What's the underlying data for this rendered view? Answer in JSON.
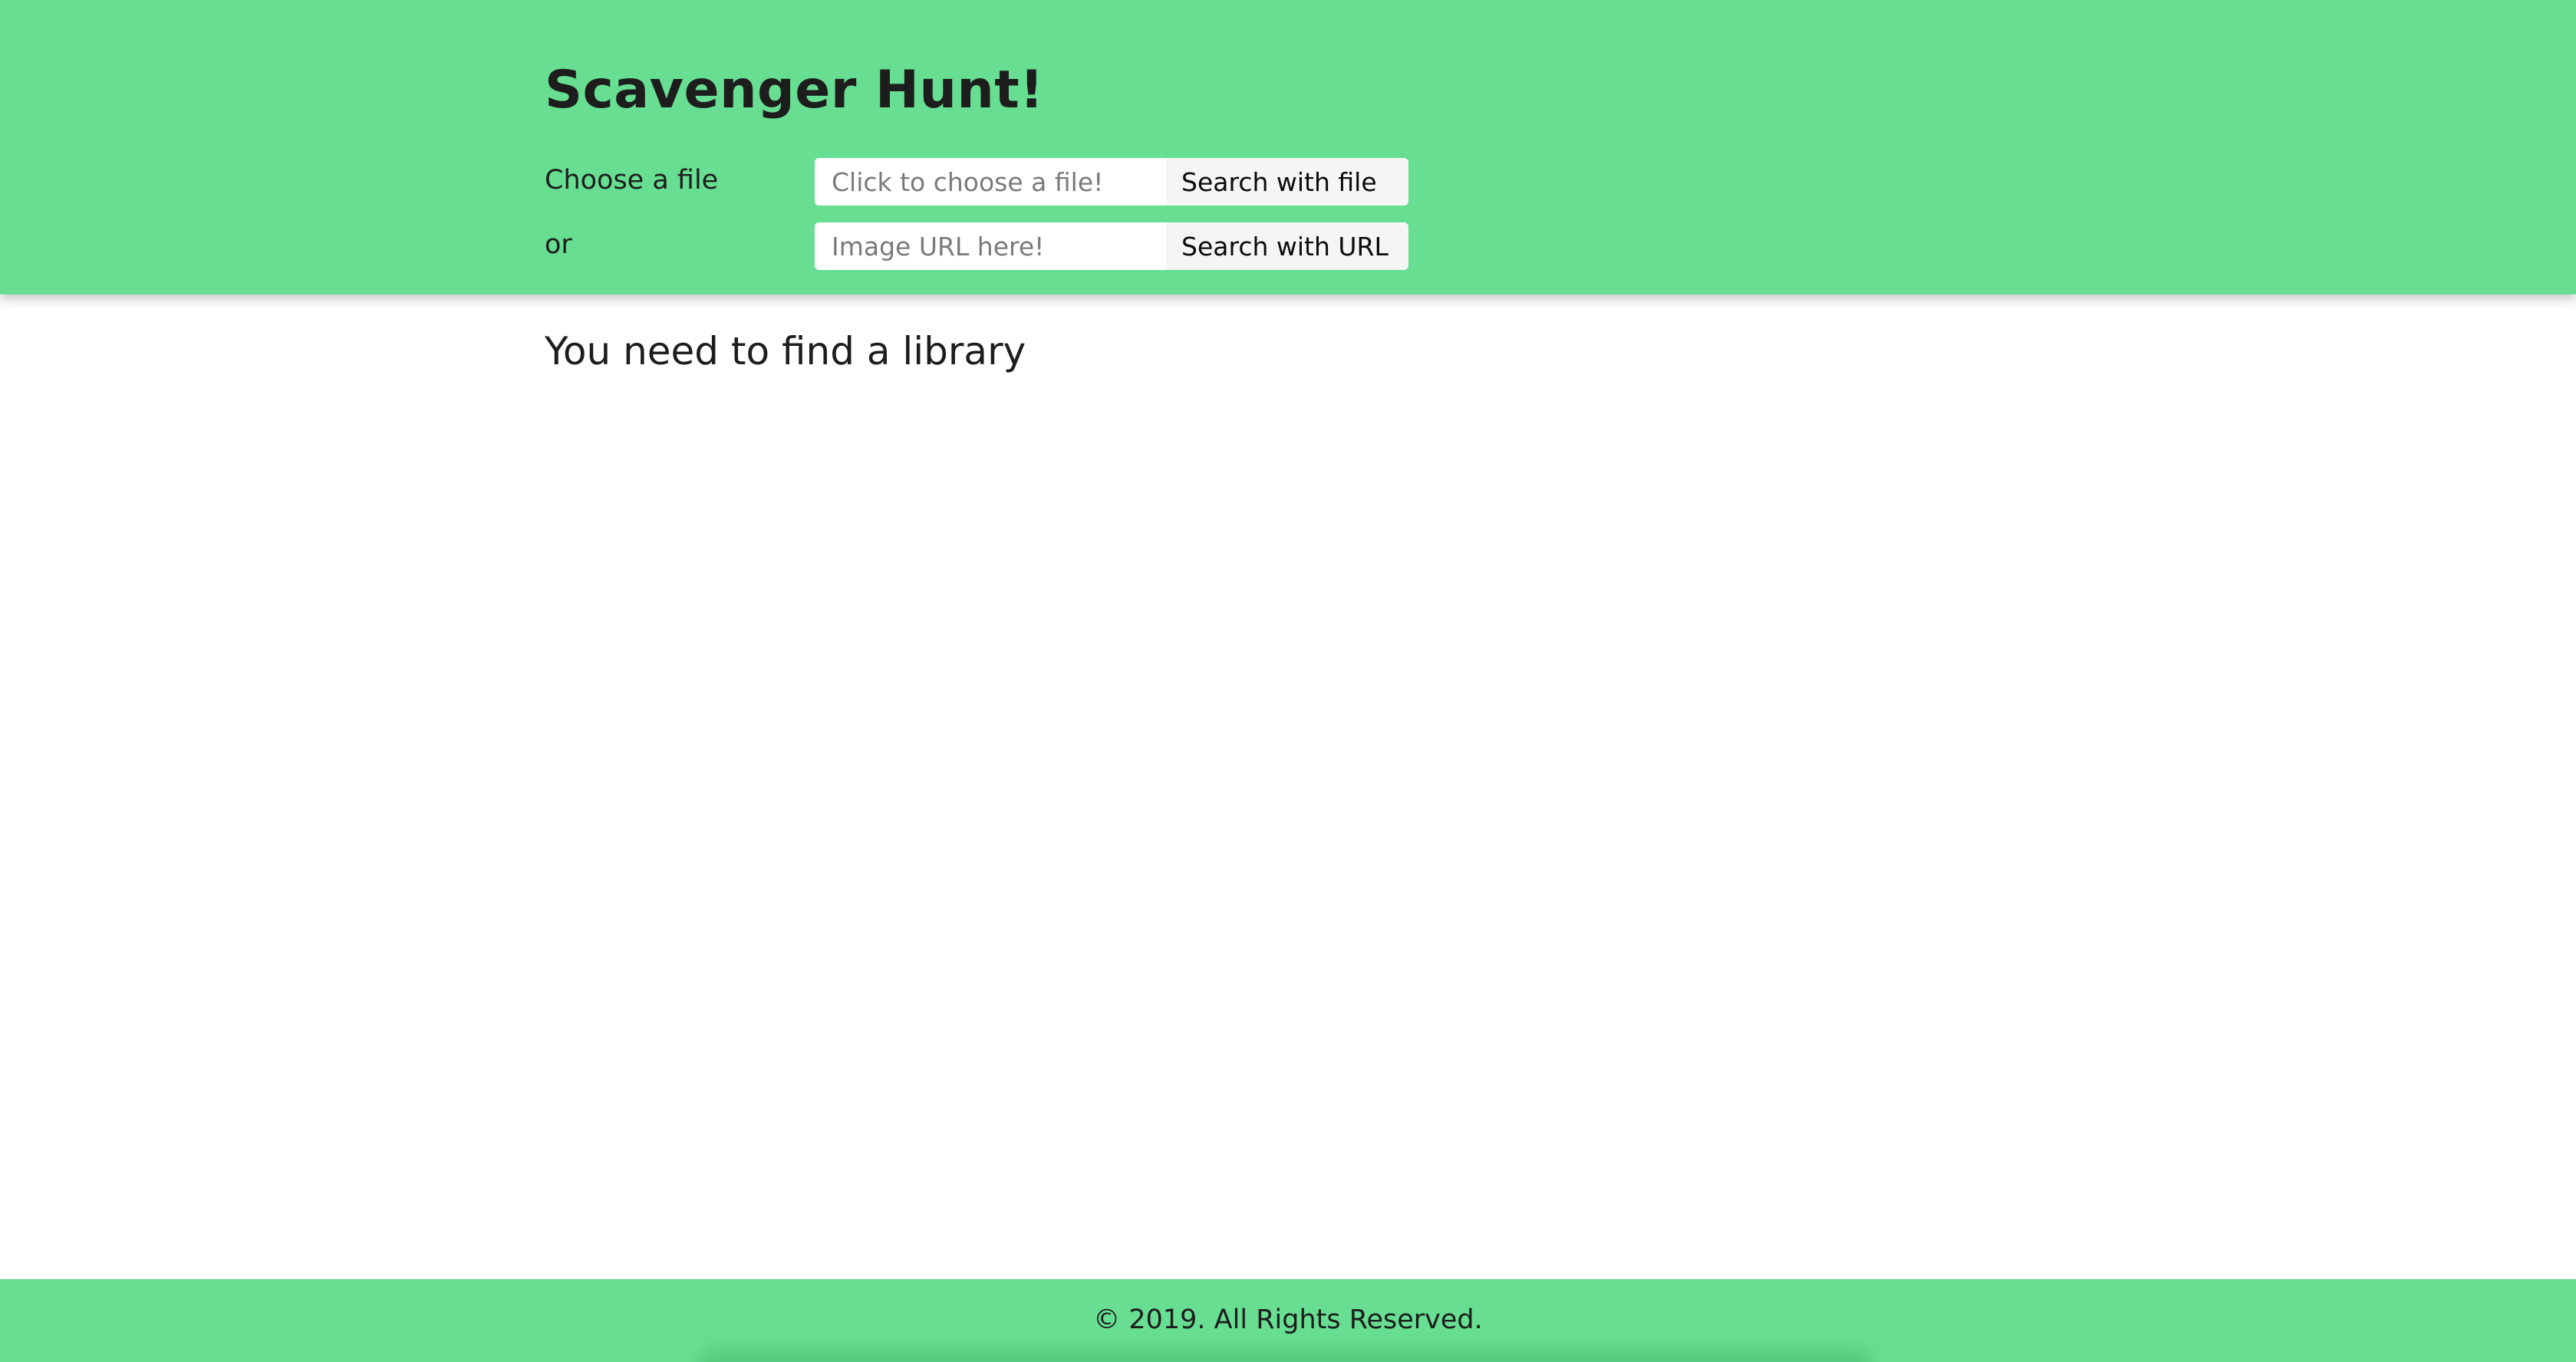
{
  "header": {
    "title": "Scavenger Hunt!",
    "file_row": {
      "label": "Choose a file",
      "placeholder": "Click to choose a file!",
      "button_label": "Search with file"
    },
    "url_row": {
      "label": "or",
      "placeholder": "Image URL here!",
      "button_label": "Search with URL"
    }
  },
  "main": {
    "prompt": "You need to find a library"
  },
  "footer": {
    "copyright": "© 2019. All Rights Reserved."
  },
  "colors": {
    "accent": "#67de91",
    "background": "#ffffff",
    "text": "#1d1d1d",
    "button_background": "#f5f5f5"
  }
}
